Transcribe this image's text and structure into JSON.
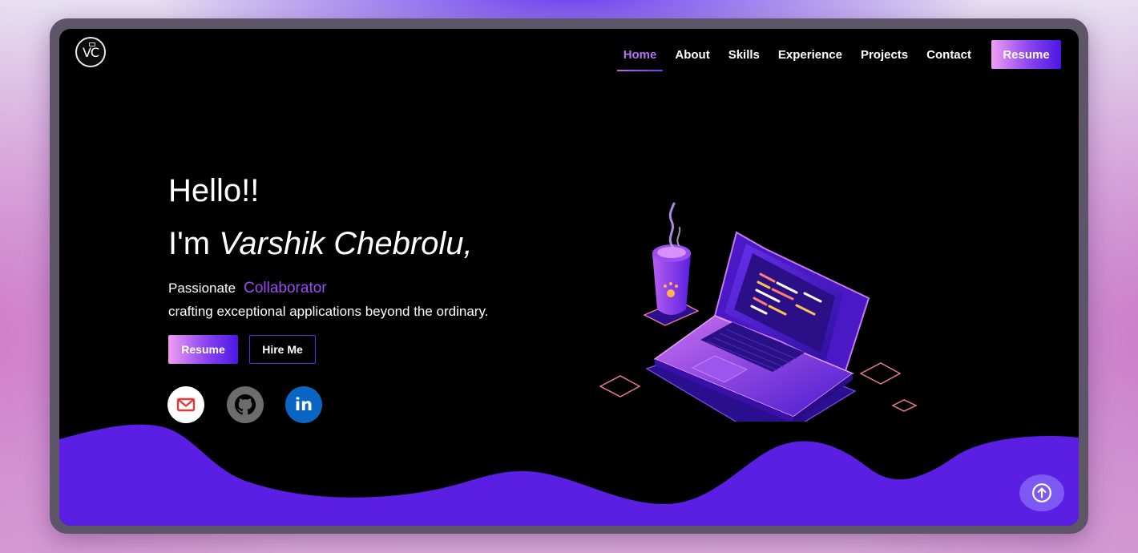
{
  "brand": {
    "logo_text": "VC",
    "logo_icon": "vc-monogram-logo"
  },
  "nav": {
    "items": [
      {
        "label": "Home",
        "active": true
      },
      {
        "label": "About"
      },
      {
        "label": "Skills"
      },
      {
        "label": "Experience"
      },
      {
        "label": "Projects"
      },
      {
        "label": "Contact"
      }
    ],
    "resume_label": "Resume"
  },
  "hero": {
    "greeting": "Hello!!",
    "intro_prefix": "I'm",
    "name": "Varshik Chebrolu,",
    "passion_prefix": "Passionate",
    "role": "Collaborator",
    "tagline": "crafting exceptional applications beyond the ordinary.",
    "resume_label": "Resume",
    "hire_label": "Hire Me"
  },
  "social": [
    {
      "icon": "gmail-icon"
    },
    {
      "icon": "github-icon"
    },
    {
      "icon": "linkedin-icon",
      "text": "in"
    }
  ],
  "colors": {
    "accent": "#6b2ff0",
    "wave": "#5b1fe4",
    "role_text": "#9a4bf5",
    "background": "#000000"
  },
  "scroll_top": {
    "icon": "arrow-up-circle-icon"
  }
}
